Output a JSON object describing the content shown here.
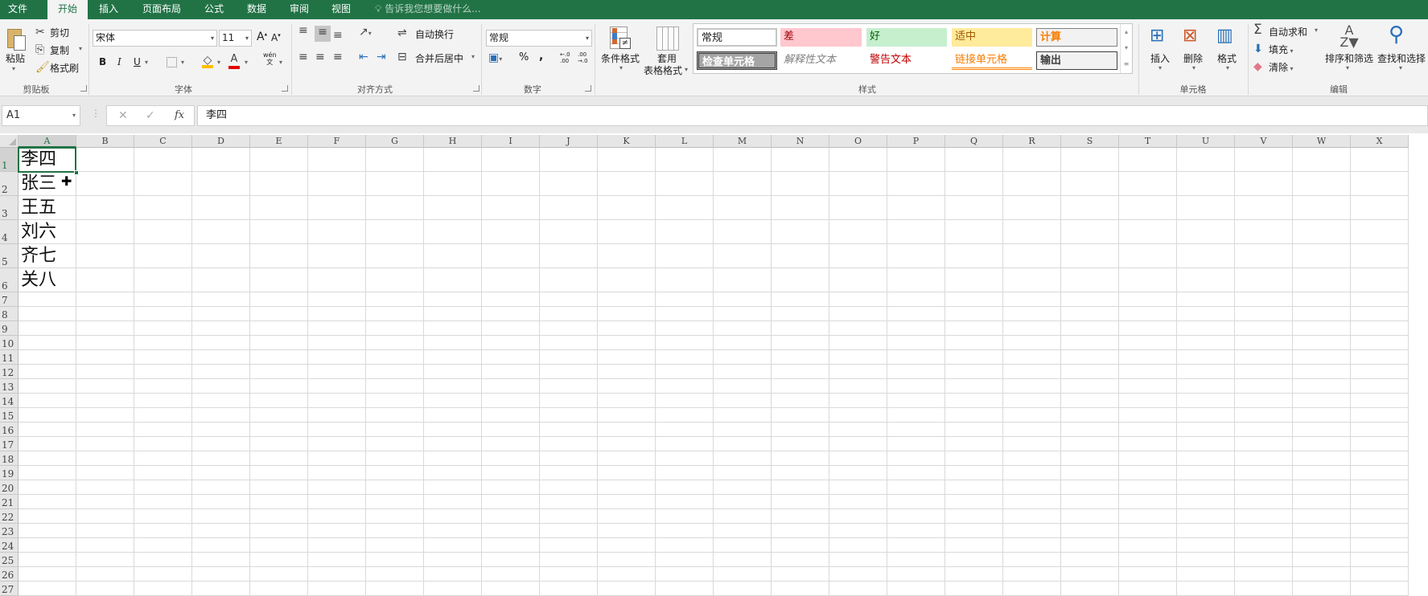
{
  "tabs": [
    {
      "label": "文件"
    },
    {
      "label": "开始",
      "active": true
    },
    {
      "label": "插入"
    },
    {
      "label": "页面布局"
    },
    {
      "label": "公式"
    },
    {
      "label": "数据"
    },
    {
      "label": "审阅"
    },
    {
      "label": "视图"
    }
  ],
  "tell_me": "告诉我您想要做什么...",
  "colors": {
    "accent": "#217346",
    "bad_bg": "#ffc7ce",
    "good_bg": "#c6efce",
    "neutral_bg": "#ffeb9c",
    "calc_text": "#fa7d00",
    "warn_text": "#c00000",
    "check_bg": "#a5a5a5"
  },
  "clipboard": {
    "paste": "粘贴",
    "cut": "剪切",
    "copy": "复制",
    "painter": "格式刷",
    "label": "剪贴板"
  },
  "font": {
    "name": "宋体",
    "size": "11",
    "bold": "B",
    "italic": "I",
    "underline": "U",
    "grow": "A",
    "shrink": "A",
    "font_color": "A",
    "phonetic": "wén",
    "label": "字体"
  },
  "alignment": {
    "wrap": "自动换行",
    "merge": "合并后居中",
    "label": "对齐方式"
  },
  "number": {
    "format": "常规",
    "percent": "%",
    "comma": ",",
    "inc": "←.0\n.00",
    "dec": ".00\n→.0",
    "label": "数字"
  },
  "cond_format": "条件格式",
  "table_format": {
    "line1": "套用",
    "line2": "表格格式"
  },
  "styles": {
    "normal": "常规",
    "bad": "差",
    "good": "好",
    "neutral": "适中",
    "calc": "计算",
    "check": "检查单元格",
    "explain": "解释性文本",
    "warning": "警告文本",
    "linked": "链接单元格",
    "output": "输出",
    "label": "样式"
  },
  "cells": {
    "insert": "插入",
    "delete": "删除",
    "format": "格式",
    "label": "单元格"
  },
  "editing": {
    "autosum": "自动求和",
    "fill": "填充",
    "clear": "清除",
    "sort": "排序和筛选",
    "find": "查找和选择",
    "label": "编辑"
  },
  "formula_bar": {
    "name_box": "A1",
    "cancel": "✕",
    "enter": "✓",
    "fx": "fx",
    "value": "李四"
  },
  "sheet": {
    "columns": [
      "A",
      "B",
      "C",
      "D",
      "E",
      "F",
      "G",
      "H",
      "I",
      "J",
      "K",
      "L",
      "M",
      "N",
      "O",
      "P",
      "Q",
      "R",
      "S",
      "T",
      "U",
      "V",
      "W",
      "X"
    ],
    "rows": [
      "1",
      "2",
      "3",
      "4",
      "5",
      "6",
      "7",
      "8",
      "9",
      "10",
      "11",
      "12",
      "13",
      "14",
      "15",
      "16",
      "17",
      "18",
      "19",
      "20",
      "21",
      "22",
      "23",
      "24",
      "25",
      "26",
      "27"
    ],
    "column_a": [
      "李四",
      "张三",
      "王五",
      "刘六",
      "齐七",
      "关八"
    ],
    "selected": "A1"
  }
}
